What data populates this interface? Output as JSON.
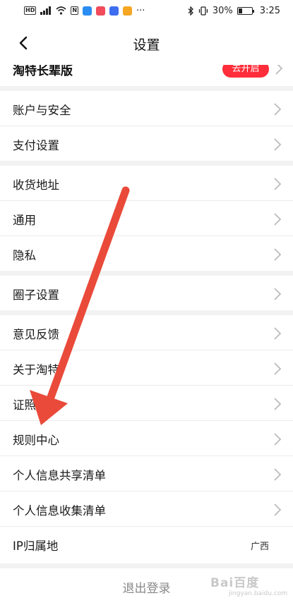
{
  "status_bar": {
    "time": "3:25",
    "battery_percent": "30%",
    "battery_level": 0.3,
    "left_icons": [
      "hd-icon",
      "signal-icon",
      "wifi-icon",
      "nfc-icon",
      "app-icons",
      "more-dots-icon"
    ],
    "right_icons": [
      "bluetooth-icon",
      "vibrate-icon",
      "battery-icon"
    ]
  },
  "nav": {
    "title": "设置",
    "back_icon": "chevron-left-icon"
  },
  "peek_row": {
    "label": "淘特长辈版",
    "action": "去开启"
  },
  "groups": [
    {
      "items": [
        {
          "label": "账户与安全"
        },
        {
          "label": "支付设置"
        }
      ]
    },
    {
      "items": [
        {
          "label": "收货地址"
        },
        {
          "label": "通用"
        },
        {
          "label": "隐私"
        }
      ]
    },
    {
      "items": [
        {
          "label": "圈子设置"
        }
      ]
    },
    {
      "items": [
        {
          "label": "意见反馈"
        },
        {
          "label": "关于淘特"
        },
        {
          "label": "证照信息"
        },
        {
          "label": "规则中心"
        },
        {
          "label": "个人信息共享清单"
        },
        {
          "label": "个人信息收集清单"
        },
        {
          "label": "IP归属地",
          "value": "广西"
        }
      ]
    }
  ],
  "logout": {
    "label": "退出登录"
  },
  "watermark": {
    "line1": "Bai百度",
    "line2": "jingyan.baidu.com"
  },
  "colors": {
    "accent_red": "#ff2e3a",
    "arrow": "#ea4a3a",
    "divider": "#f2f2f2"
  }
}
